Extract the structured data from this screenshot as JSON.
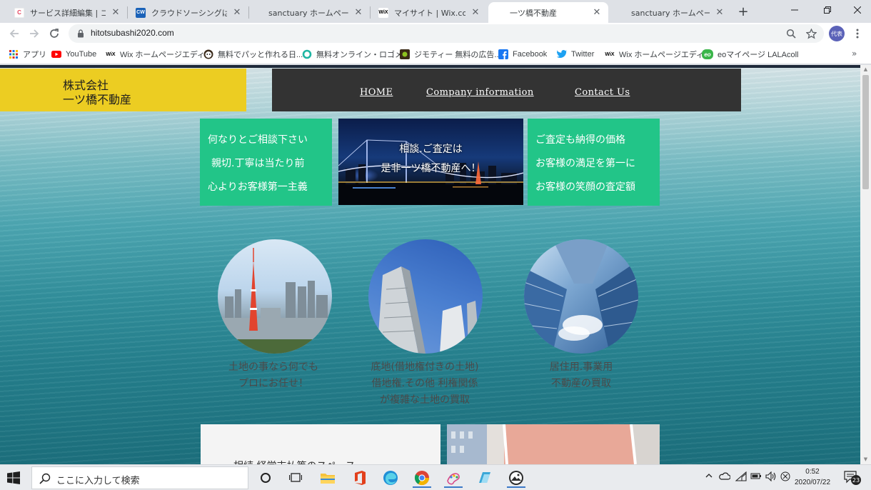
{
  "tabs": [
    {
      "title": "サービス詳細編集 | ココナラ",
      "favicon_letter": "C",
      "favicon_color": "#ffffff",
      "favicon_fg": "#e6425e",
      "active": false
    },
    {
      "title": "クラウドソーシングは日本最大級の",
      "favicon_letter": "CW",
      "favicon_color": "#1a62b8",
      "favicon_fg": "#ffffff",
      "active": false
    },
    {
      "title": "sanctuary ホームページ制作",
      "favicon_letter": "",
      "favicon_color": "transparent",
      "favicon_fg": "#ffffff",
      "active": false
    },
    {
      "title": "マイサイト | Wix.com",
      "favicon_letter": "WiX",
      "favicon_color": "#ffffff",
      "favicon_fg": "#000000",
      "active": false
    },
    {
      "title": "一ツ橋不動産",
      "favicon_letter": "",
      "favicon_color": "transparent",
      "favicon_fg": "#ffffff",
      "active": true
    },
    {
      "title": "sanctuary ホームページ制作",
      "favicon_letter": "",
      "favicon_color": "transparent",
      "favicon_fg": "#ffffff",
      "active": false
    }
  ],
  "toolbar": {
    "url": "hitotsubashi2020.com",
    "profile_label": "代表"
  },
  "bookmarks": [
    {
      "label": "アプリ",
      "icon": "apps-grid-icon"
    },
    {
      "label": "YouTube",
      "icon": "youtube-icon"
    },
    {
      "label": "Wix ホームページエディ...",
      "icon": "wix-icon"
    },
    {
      "label": "無料でパッと作れる日...",
      "icon": "face-icon"
    },
    {
      "label": "無料オンライン・ロゴメ...",
      "icon": "ring-icon"
    },
    {
      "label": "ジモティー 無料の広告...",
      "icon": "jmty-icon"
    },
    {
      "label": "Facebook",
      "icon": "facebook-icon"
    },
    {
      "label": "Twitter",
      "icon": "twitter-icon"
    },
    {
      "label": "Wix ホームページエディタ",
      "icon": "wix-icon"
    },
    {
      "label": "eoマイページ LALAcoll",
      "icon": "eo-icon"
    }
  ],
  "site": {
    "logo_line1": "株式会社",
    "logo_line2": "一ツ橋不動産",
    "nav": [
      "HOME",
      "Company information",
      "Contact Us"
    ],
    "box_left_lines": [
      "何なりとご相談下さい",
      "親切.丁寧は当たり前",
      "心よりお客様第一主義"
    ],
    "box_center_lines": [
      "相談.ご査定は",
      "是非一ツ橋不動産へ！"
    ],
    "box_right_lines": [
      "ご査定も納得の価格",
      "お客様の満足を第一に",
      "お客様の笑顔の査定額"
    ],
    "circles": [
      {
        "lines": [
          "土地の事なら何でも",
          "プロにお任せ！"
        ]
      },
      {
        "lines": [
          "底地(借地権付きの土地)",
          "借地権.その他 利権関係",
          "が複雑な土地の買取"
        ]
      },
      {
        "lines": [
          "居住用.事業用",
          "不動産の買取"
        ]
      }
    ],
    "panel_text": "相続.経営支払等のスペース"
  },
  "taskbar": {
    "search_placeholder": "ここに入力して検索",
    "time": "0:52",
    "date": "2020/07/22",
    "notifications": "23"
  },
  "colors": {
    "logo_bg": "#eccd22",
    "nav_bg": "#333333",
    "green": "#22c588"
  }
}
